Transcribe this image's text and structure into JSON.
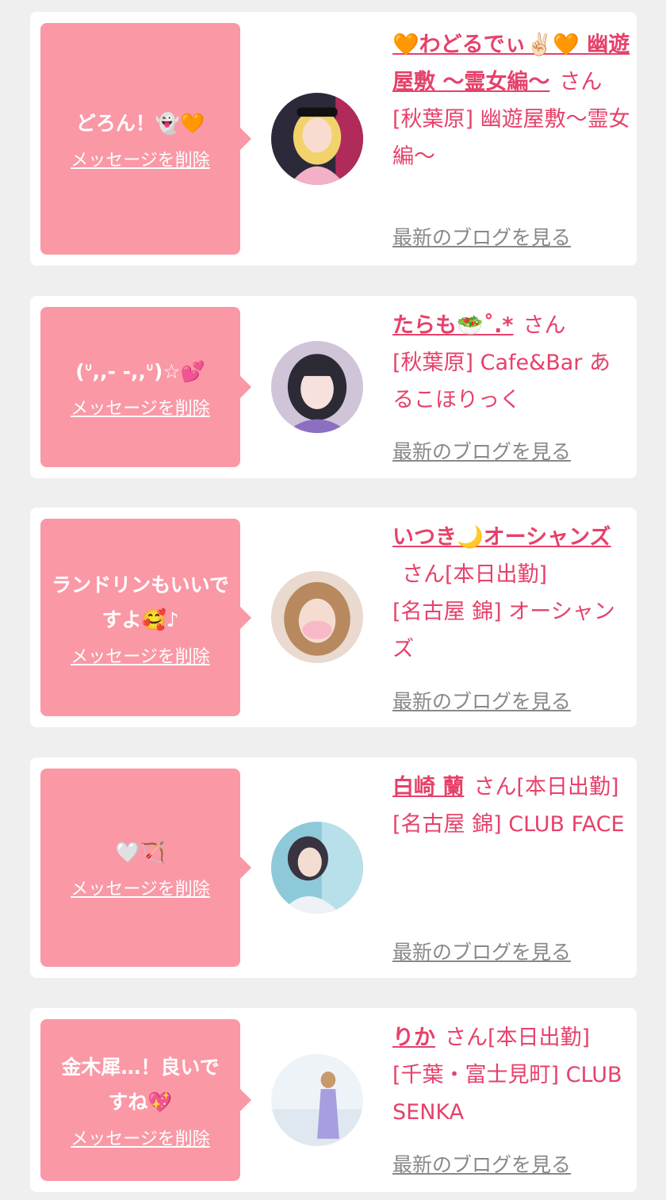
{
  "delete_label": "メッセージを削除",
  "blog_label": "最新のブログを見る",
  "san": "さん",
  "items": [
    {
      "message": "どろん！👻🧡",
      "name": "🧡わどるでぃ✌🏻🧡 幽遊屋敷 〜霊女編〜",
      "status": "",
      "shop": "[秋葉原] 幽遊屋敷〜霊女編〜"
    },
    {
      "message": "(ᐡ,,- -,,ᐡ)☆💕",
      "name": "たらも🥗˚.*",
      "status": "",
      "shop": "[秋葉原] Cafe&Bar あるこほりっく"
    },
    {
      "message": "ランドリンもいいですよ🥰♪",
      "name": "いつき🌙オーシャンズ",
      "status": "[本日出勤]",
      "shop": "[名古屋 錦] オーシャンズ"
    },
    {
      "message": "🤍🏹",
      "name": "白崎 蘭",
      "status": "[本日出勤]",
      "shop": "[名古屋 錦] CLUB FACE"
    },
    {
      "message": "金木犀…！良いですね💖",
      "name": "りか",
      "status": "[本日出勤]",
      "shop": "[千葉・富士見町] CLUB SENKA"
    }
  ]
}
